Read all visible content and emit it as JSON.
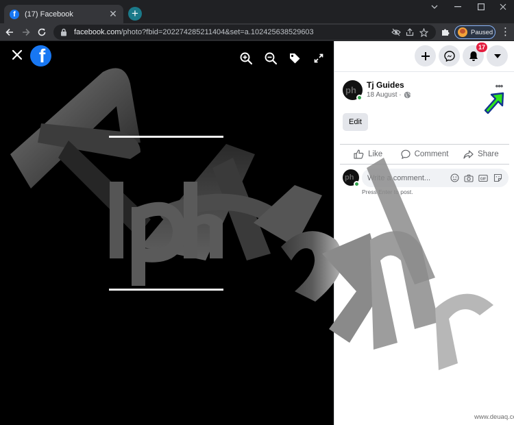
{
  "browser": {
    "tab_title": "(17) Facebook",
    "tab_favicon_icon": "facebook-f-icon",
    "new_tab_label": "+",
    "url_host": "facebook.com",
    "url_path": "/photo?fbid=202274285211404&set=a.102425638529603",
    "profile_label": "Paused",
    "window_controls": [
      "minimize-icon",
      "maximize-icon",
      "close-icon"
    ],
    "accent_color": "#8ab4f8"
  },
  "viewer": {
    "toolbar_icons": [
      "zoom-in-icon",
      "zoom-out-icon",
      "tag-icon",
      "fullscreen-icon"
    ],
    "logo_letter": "f",
    "background_color": "#000000"
  },
  "panel": {
    "nav_icons": [
      "plus-icon",
      "messenger-icon",
      "bell-icon",
      "caret-down-icon"
    ],
    "notification_count": "17",
    "author": "Tj Guides",
    "date": "18 August ·",
    "edit_label": "Edit",
    "like_label": "Like",
    "comment_label": "Comment",
    "share_label": "Share",
    "comment_placeholder": "Write a comment...",
    "comment_icons": [
      "emoji-icon",
      "camera-icon",
      "gif-icon",
      "sticker-icon"
    ],
    "press_enter": "Press Enter to post.",
    "brand_color": "#1877f2",
    "online_color": "#31a24c"
  },
  "watermark": "www.deuaq.com"
}
